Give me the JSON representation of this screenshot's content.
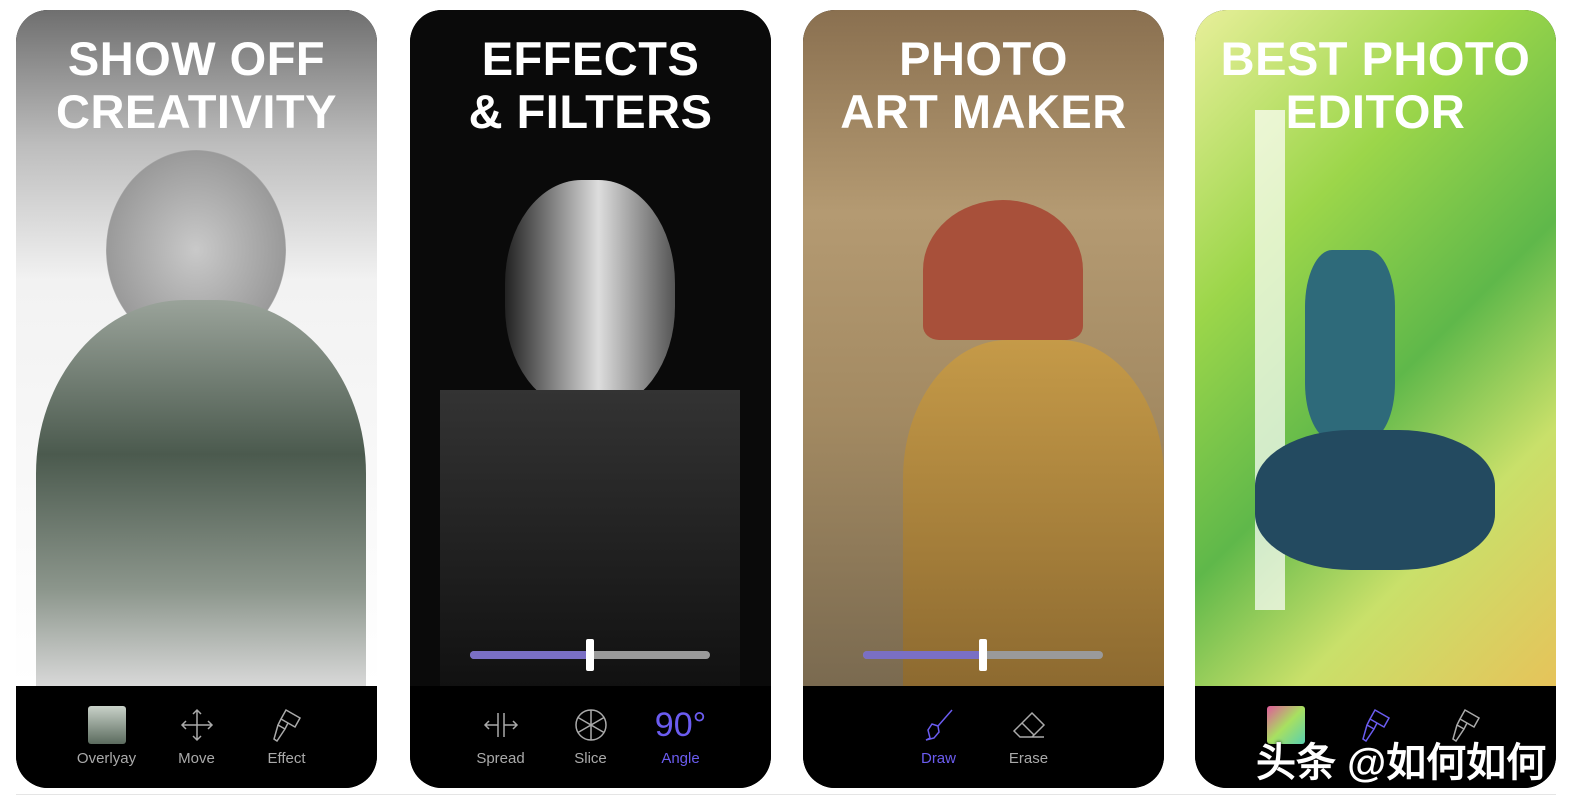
{
  "cards": [
    {
      "title": [
        "SHOW OFF",
        "CREATIVITY"
      ],
      "tools": [
        {
          "label": "Overlyay",
          "icon": "thumbnail-icon"
        },
        {
          "label": "Move",
          "icon": "move-arrows-icon"
        },
        {
          "label": "Effect",
          "icon": "brush-icon"
        }
      ]
    },
    {
      "title": [
        "EFFECTS",
        "& FILTERS"
      ],
      "slider_value": 0.5,
      "tools": [
        {
          "label": "Spread",
          "icon": "spread-icon"
        },
        {
          "label": "Slice",
          "icon": "slice-wheel-icon"
        },
        {
          "label": "Angle",
          "value": "90°",
          "active": true
        }
      ]
    },
    {
      "title": [
        "PHOTO",
        "ART MAKER"
      ],
      "slider_value": 0.5,
      "tools": [
        {
          "label": "Draw",
          "icon": "brush-icon",
          "active": true
        },
        {
          "label": "Erase",
          "icon": "eraser-icon"
        }
      ]
    },
    {
      "title": [
        "BEST PHOTO",
        "EDITOR"
      ],
      "tools": [
        {
          "icon": "thumbnail-icon"
        },
        {
          "icon": "brush-icon",
          "active": true
        },
        {
          "icon": "brush-icon"
        }
      ]
    }
  ],
  "watermark": "头条 @如何如何",
  "colors": {
    "accent": "#6b5cf0",
    "slider_fill": "#7a6fc4"
  }
}
